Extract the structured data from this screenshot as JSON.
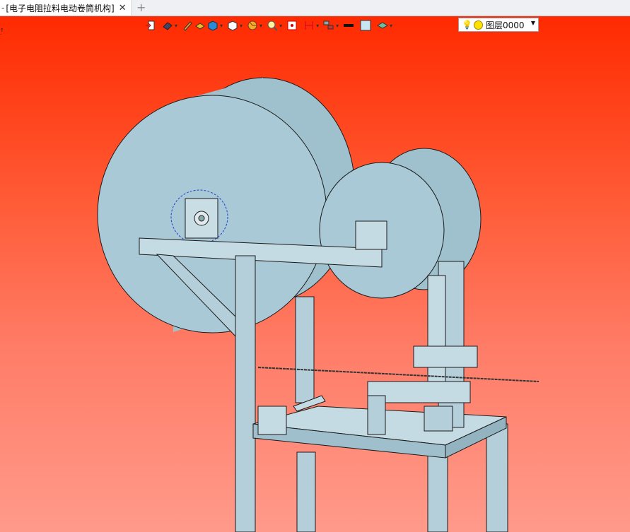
{
  "tab": {
    "lead": "-",
    "title": "[电子电阻拉料电动卷筒机构]",
    "close": "✕",
    "new": "+"
  },
  "toolbar": {
    "items": [
      "import-icon",
      "view-orient-icon",
      "pencil-icon",
      "fill-shaded-icon",
      "cube-color-icon",
      "cube-white-icon",
      "section-pie-icon",
      "zoom-icon",
      "fit-view-icon",
      "dimension-icon",
      "assembly-icon",
      "line-color-swatch",
      "face-color-swatch",
      "layer-stack-icon"
    ],
    "layer_name": "图层0000",
    "colors": {
      "line": "#111111",
      "face": "#c8e6f2"
    }
  },
  "viewport": {
    "background_top": "#ff2a00",
    "background_bottom": "#ff9a8a",
    "model_fill": "#a9c9d6",
    "model_stroke": "#1a1a1a"
  }
}
